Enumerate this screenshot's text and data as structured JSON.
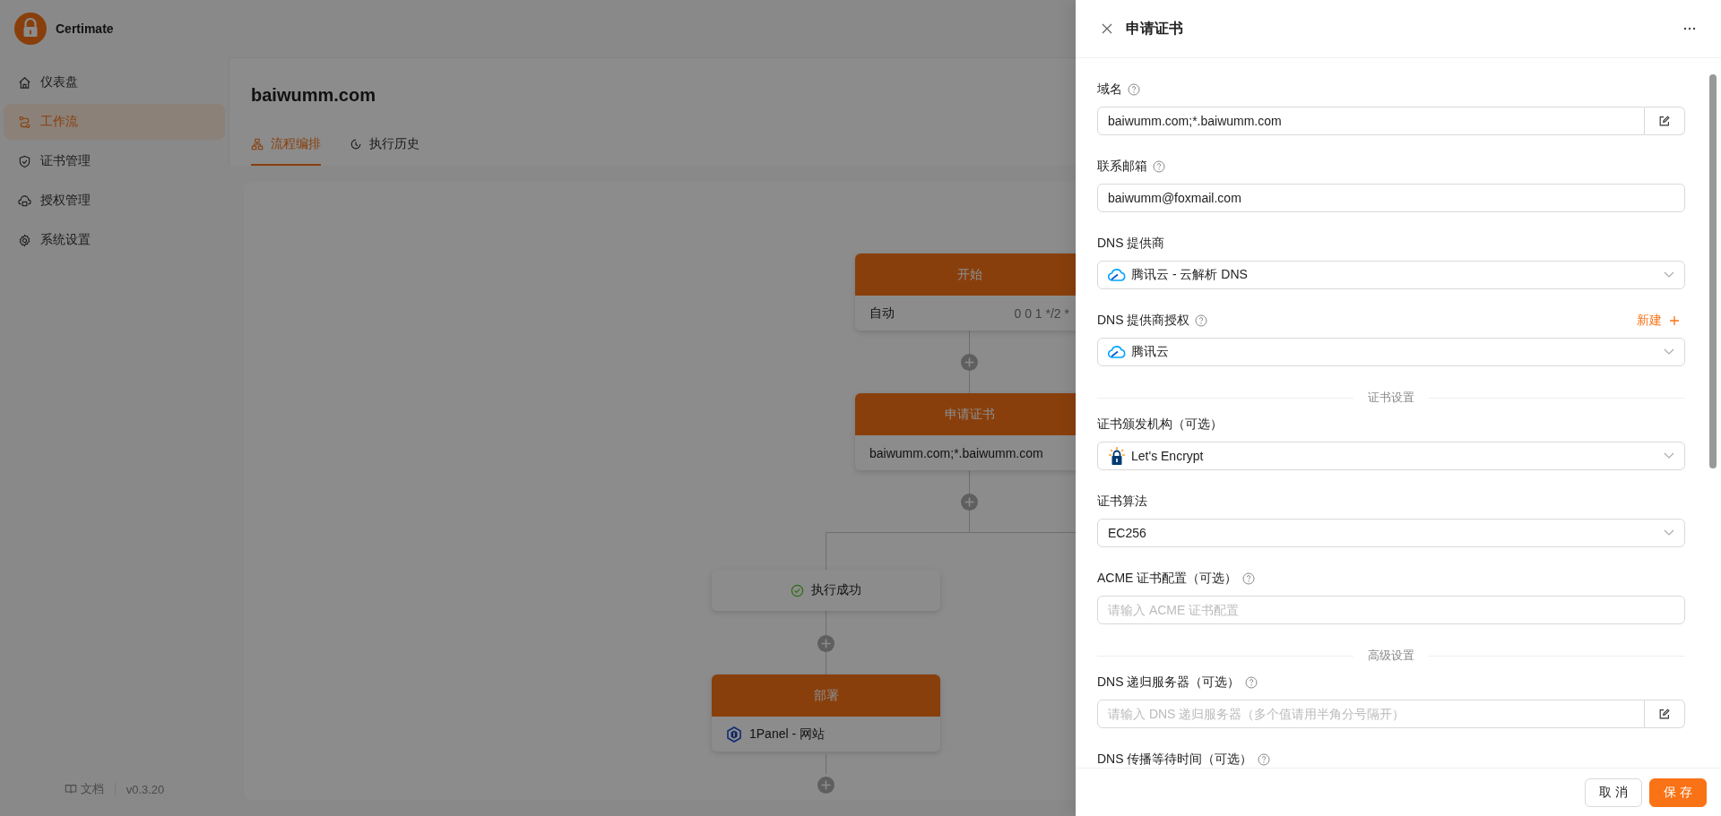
{
  "app": {
    "name": "Certimate"
  },
  "sidebar": {
    "items": [
      {
        "label": "仪表盘",
        "selected": false
      },
      {
        "label": "工作流",
        "selected": true
      },
      {
        "label": "证书管理",
        "selected": false
      },
      {
        "label": "授权管理",
        "selected": false
      },
      {
        "label": "系统设置",
        "selected": false
      }
    ],
    "footer": {
      "docs": "文档",
      "version": "v0.3.20"
    }
  },
  "page": {
    "title": "baiwumm.com",
    "tabs": [
      {
        "label": "流程编排",
        "selected": true
      },
      {
        "label": "执行历史",
        "selected": false
      }
    ]
  },
  "workflow": {
    "nodes": [
      {
        "kind": "start",
        "title": "开始",
        "label": "自动",
        "detail": "0 0 1 */2 *"
      },
      {
        "kind": "apply",
        "title": "申请证书",
        "detail": "baiwumm.com;*.baiwumm.com"
      },
      {
        "kind": "condition",
        "label": "执行成功"
      },
      {
        "kind": "deploy",
        "title": "部署",
        "label": "1Panel - 网站"
      }
    ]
  },
  "drawer": {
    "title": "申请证书",
    "fields": [
      {
        "kind": "input",
        "label": "域名",
        "help": true,
        "value": "baiwumm.com;*.baiwumm.com",
        "edit_button": true
      },
      {
        "kind": "input",
        "label": "联系邮箱",
        "help": true,
        "value": "baiwumm@foxmail.com"
      },
      {
        "kind": "select",
        "label": "DNS 提供商",
        "value": "腾讯云 - 云解析 DNS"
      },
      {
        "kind": "select",
        "label": "DNS 提供商授权",
        "help": true,
        "value": "腾讯云",
        "action": "新建"
      },
      {
        "kind": "divider",
        "label": "证书设置"
      },
      {
        "kind": "select",
        "label": "证书颁发机构（可选）",
        "value": "Let's Encrypt"
      },
      {
        "kind": "select",
        "label": "证书算法",
        "value": "EC256"
      },
      {
        "kind": "input",
        "label": "ACME 证书配置（可选）",
        "help": true,
        "placeholder": "请输入 ACME 证书配置"
      },
      {
        "kind": "divider",
        "label": "高级设置"
      },
      {
        "kind": "input",
        "label": "DNS 递归服务器（可选）",
        "help": true,
        "placeholder": "请输入 DNS 递归服务器（多个值请用半角分号隔开）",
        "edit_button": true
      },
      {
        "kind": "label",
        "label": "DNS 传播等待时间（可选）",
        "help": true
      }
    ],
    "buttons": [
      {
        "kind": "default",
        "label": "取 消"
      },
      {
        "kind": "primary",
        "label": "保 存"
      }
    ]
  }
}
